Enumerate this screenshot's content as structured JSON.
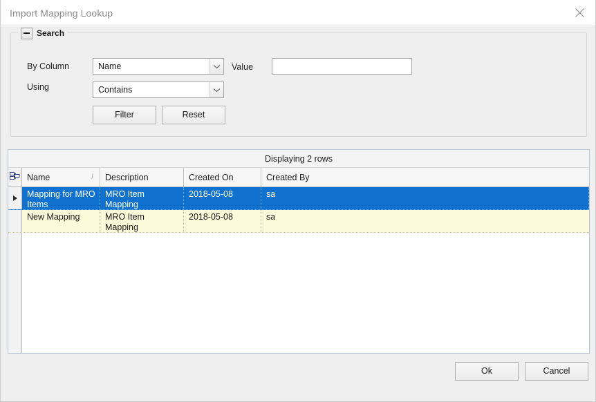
{
  "window": {
    "title": "Import Mapping Lookup",
    "close_icon": "close-icon"
  },
  "search_panel": {
    "legend": "Search",
    "collapse_icon": "minus-icon",
    "fields": {
      "by_column_label": "By Column",
      "by_column_value": "Name",
      "using_label": "Using",
      "using_value": "Contains",
      "value_label": "Value",
      "value_text": "",
      "value_placeholder": ""
    },
    "buttons": {
      "filter": "Filter",
      "reset": "Reset"
    }
  },
  "grid": {
    "caption": "Displaying 2 rows",
    "column_chooser_icon": "grid-column-chooser-icon",
    "row_indicator_icon": "current-row-arrow-icon",
    "sort_indicator": "/",
    "columns": [
      {
        "key": "name",
        "label": "Name",
        "sorted": "ascending"
      },
      {
        "key": "description",
        "label": "Description",
        "sorted": ""
      },
      {
        "key": "created_on",
        "label": "Created On",
        "sorted": ""
      },
      {
        "key": "created_by",
        "label": "Created By",
        "sorted": ""
      }
    ],
    "rows": [
      {
        "name": "Mapping for MRO Items",
        "description": "MRO Item Mapping",
        "created_on": "2018-05-08",
        "created_by": "sa",
        "selected": true
      },
      {
        "name": "New Mapping",
        "description": "MRO Item Mapping",
        "created_on": "2018-05-08",
        "created_by": "sa",
        "selected": false
      }
    ]
  },
  "footer": {
    "ok": "Ok",
    "cancel": "Cancel"
  },
  "colors": {
    "selection_blue": "#1171ce",
    "alt_row_yellow": "#fbfbd9",
    "dialog_background": "#efefef",
    "title_text": "#8d8d8d"
  }
}
